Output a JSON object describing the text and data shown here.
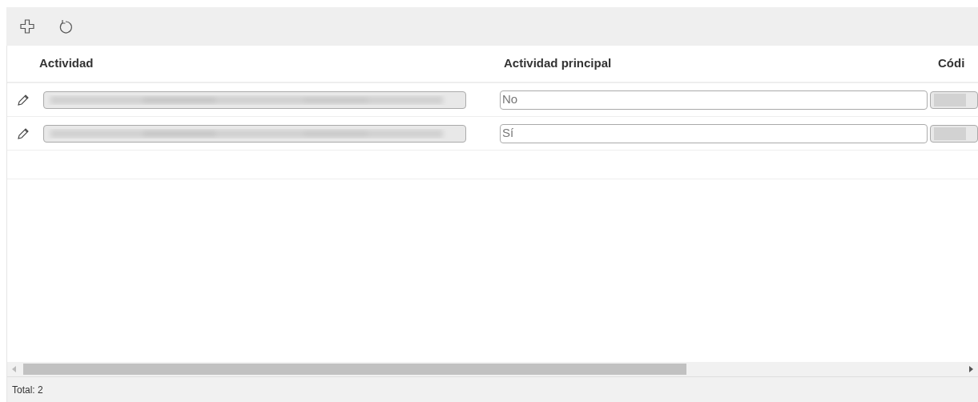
{
  "toolbar": {
    "buttons": [
      {
        "kind": "add"
      },
      {
        "kind": "refresh"
      }
    ]
  },
  "table": {
    "columns": [
      "Actividad",
      "Actividad principal",
      "Códi"
    ],
    "rows": [
      {
        "actividad": {
          "kind": "redacted"
        },
        "principal": "No",
        "codigo": {
          "kind": "redacted"
        }
      },
      {
        "actividad": {
          "kind": "redacted"
        },
        "principal": "Sí",
        "codigo": {
          "kind": "redacted"
        }
      }
    ]
  },
  "footer": {
    "total": "Total: 2"
  }
}
